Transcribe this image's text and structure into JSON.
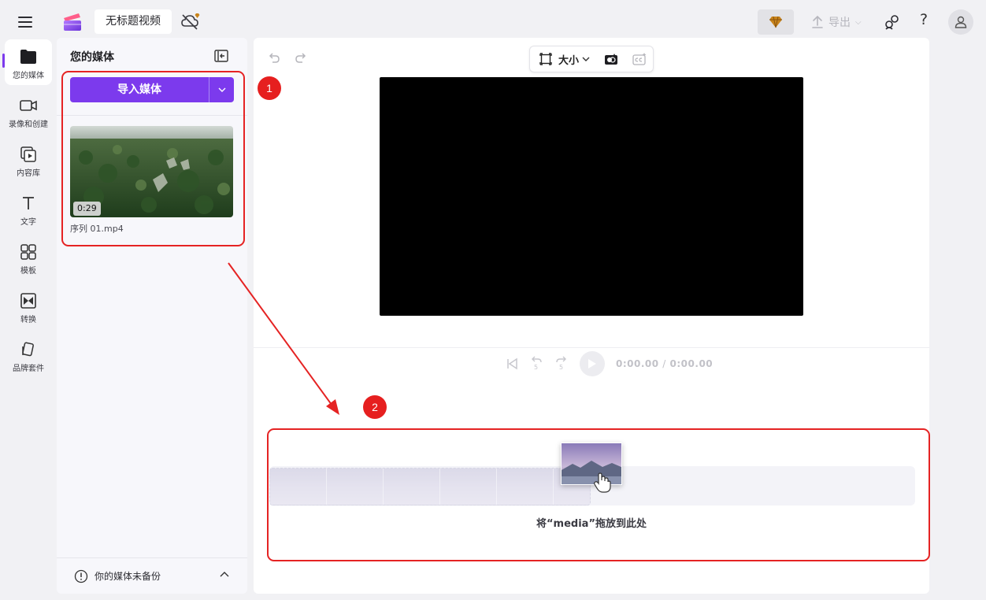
{
  "topbar": {
    "project_title": "无标题视频",
    "export_label": "导出",
    "help_glyph": "?",
    "icons": [
      "menu-icon",
      "app-logo-icon",
      "cloud-off-icon",
      "premium-diamond-icon",
      "upload-icon",
      "share-icon",
      "help-icon",
      "user-icon"
    ]
  },
  "rail": {
    "items": [
      {
        "label": "您的媒体",
        "icon": "folder-icon",
        "active": true
      },
      {
        "label": "录像和创建",
        "icon": "video-camera-icon"
      },
      {
        "label": "内容库",
        "icon": "content-library-icon"
      },
      {
        "label": "文字",
        "icon": "text-icon"
      },
      {
        "label": "模板",
        "icon": "templates-icon"
      },
      {
        "label": "转换",
        "icon": "transitions-icon"
      },
      {
        "label": "品牌套件",
        "icon": "brand-kit-icon"
      }
    ]
  },
  "media_panel": {
    "title": "您的媒体",
    "import_label": "导入媒体",
    "items": [
      {
        "duration": "0:29",
        "file_name": "序列 01.mp4"
      }
    ],
    "backup_notice": "你的媒体未备份"
  },
  "stage": {
    "size_label": "大小",
    "rewind_seconds": "5",
    "forward_seconds": "5",
    "current_time": "0:00.00",
    "time_separator": "/",
    "total_time": "0:00.00",
    "drop_hint": "将“media”拖放到此处"
  },
  "annotations": [
    {
      "number": "1"
    },
    {
      "number": "2"
    }
  ],
  "colors": {
    "accent": "#7c3aed",
    "annotation_red": "#e52323",
    "canvas": "#000000",
    "premium_gold": "#c9841b"
  }
}
